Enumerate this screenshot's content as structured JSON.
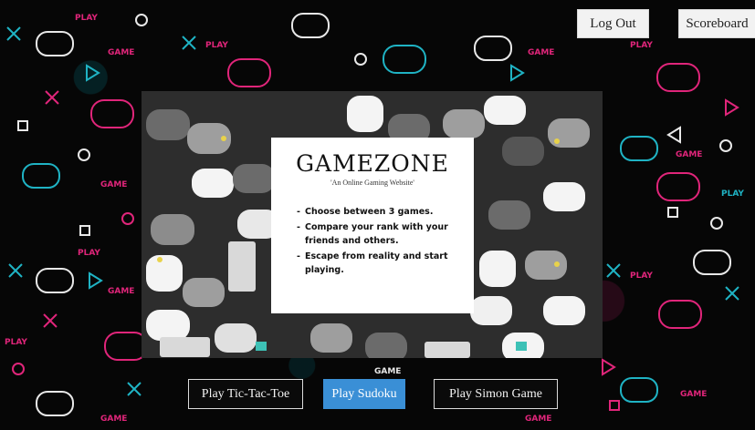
{
  "header": {
    "logout_label": "Log Out",
    "scoreboard_label": "Scoreboard"
  },
  "card": {
    "title": "GAMEZONE",
    "subtitle": "'An Online Gaming Website'",
    "features": [
      "Choose between 3 games.",
      "Compare your rank with your friends and others.",
      "Escape from reality and start playing."
    ]
  },
  "games": {
    "tictactoe_label": "Play Tic-Tac-Toe",
    "sudoku_label": "Play Sudoku",
    "simon_label": "Play Simon Game"
  },
  "colors": {
    "accent_pink": "#e0257a",
    "accent_cyan": "#1fb3c4",
    "sudoku_button": "#3a8fd6"
  },
  "icons": [
    "gamepad-icon",
    "cross-icon",
    "triangle-icon",
    "circle-icon",
    "square-icon"
  ]
}
